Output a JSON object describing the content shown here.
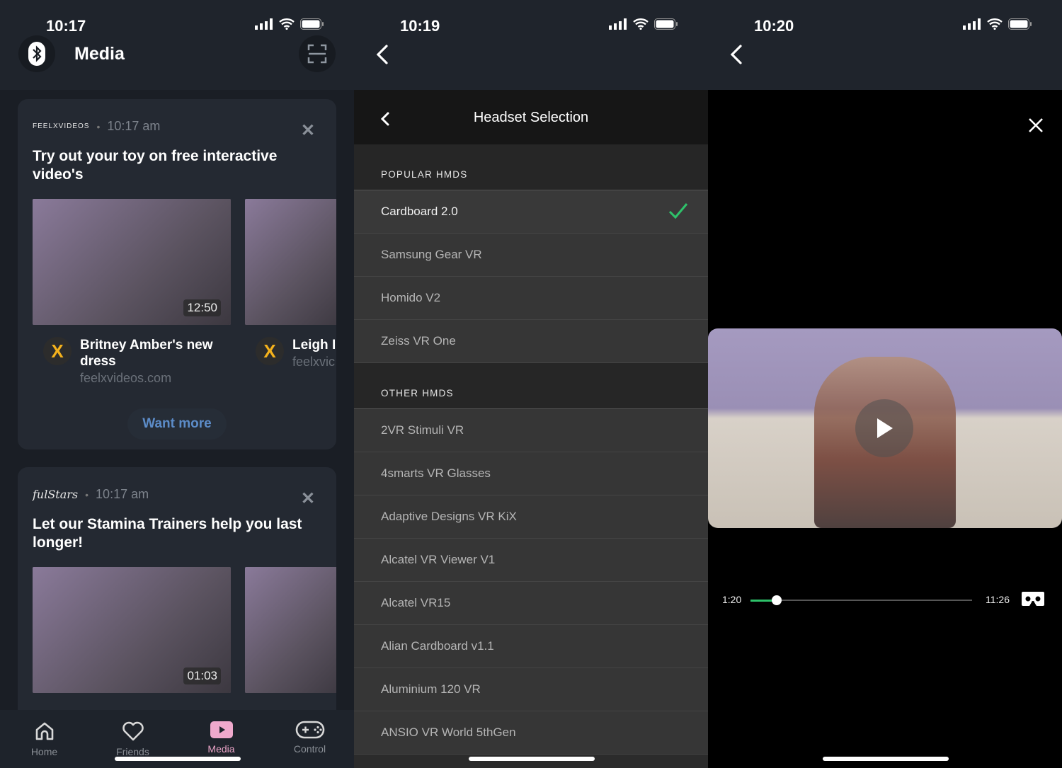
{
  "panel1": {
    "status_time": "10:17",
    "title": "Media",
    "cards": [
      {
        "brand": "FEELXVIDEOS",
        "time": "10:17 am",
        "title": "Try out your toy on free interactive video's",
        "videos": [
          {
            "title": "Britney Amber's new dress",
            "site": "feelxvideos.com",
            "duration": "12:50"
          },
          {
            "title": "Leigh I",
            "site": "feelxvic",
            "duration": ""
          }
        ],
        "cta": "Want more"
      },
      {
        "brand": "fulStars",
        "time": "10:17 am",
        "title": "Let our Stamina Trainers help you last longer!",
        "videos": [
          {
            "duration": "01:03"
          },
          {
            "duration": ""
          }
        ]
      }
    ],
    "tabs": [
      {
        "label": "Home",
        "icon": "home-icon"
      },
      {
        "label": "Friends",
        "icon": "heart-icon"
      },
      {
        "label": "Media",
        "icon": "play-icon",
        "active": true
      },
      {
        "label": "Control",
        "icon": "gamepad-icon"
      }
    ]
  },
  "panel2": {
    "status_time": "10:19",
    "header_title": "Headset Selection",
    "sections": [
      {
        "label": "POPULAR HMDS",
        "items": [
          "Cardboard 2.0",
          "Samsung Gear VR",
          "Homido V2",
          "Zeiss VR One"
        ]
      },
      {
        "label": "OTHER HMDS",
        "items": [
          "2VR Stimuli VR",
          "4smarts VR Glasses",
          "Adaptive Designs VR KiX",
          "Alcatel VR Viewer V1",
          "Alcatel VR15",
          "Alian Cardboard v1.1",
          "Aluminium 120 VR",
          "ANSIO VR World 5thGen"
        ]
      }
    ],
    "selected": "Cardboard 2.0",
    "accent": "#2ec26a"
  },
  "panel3": {
    "status_time": "10:20",
    "current_time": "1:20",
    "total_time": "11:26",
    "progress": 0.117,
    "accent": "#2ec26a"
  }
}
